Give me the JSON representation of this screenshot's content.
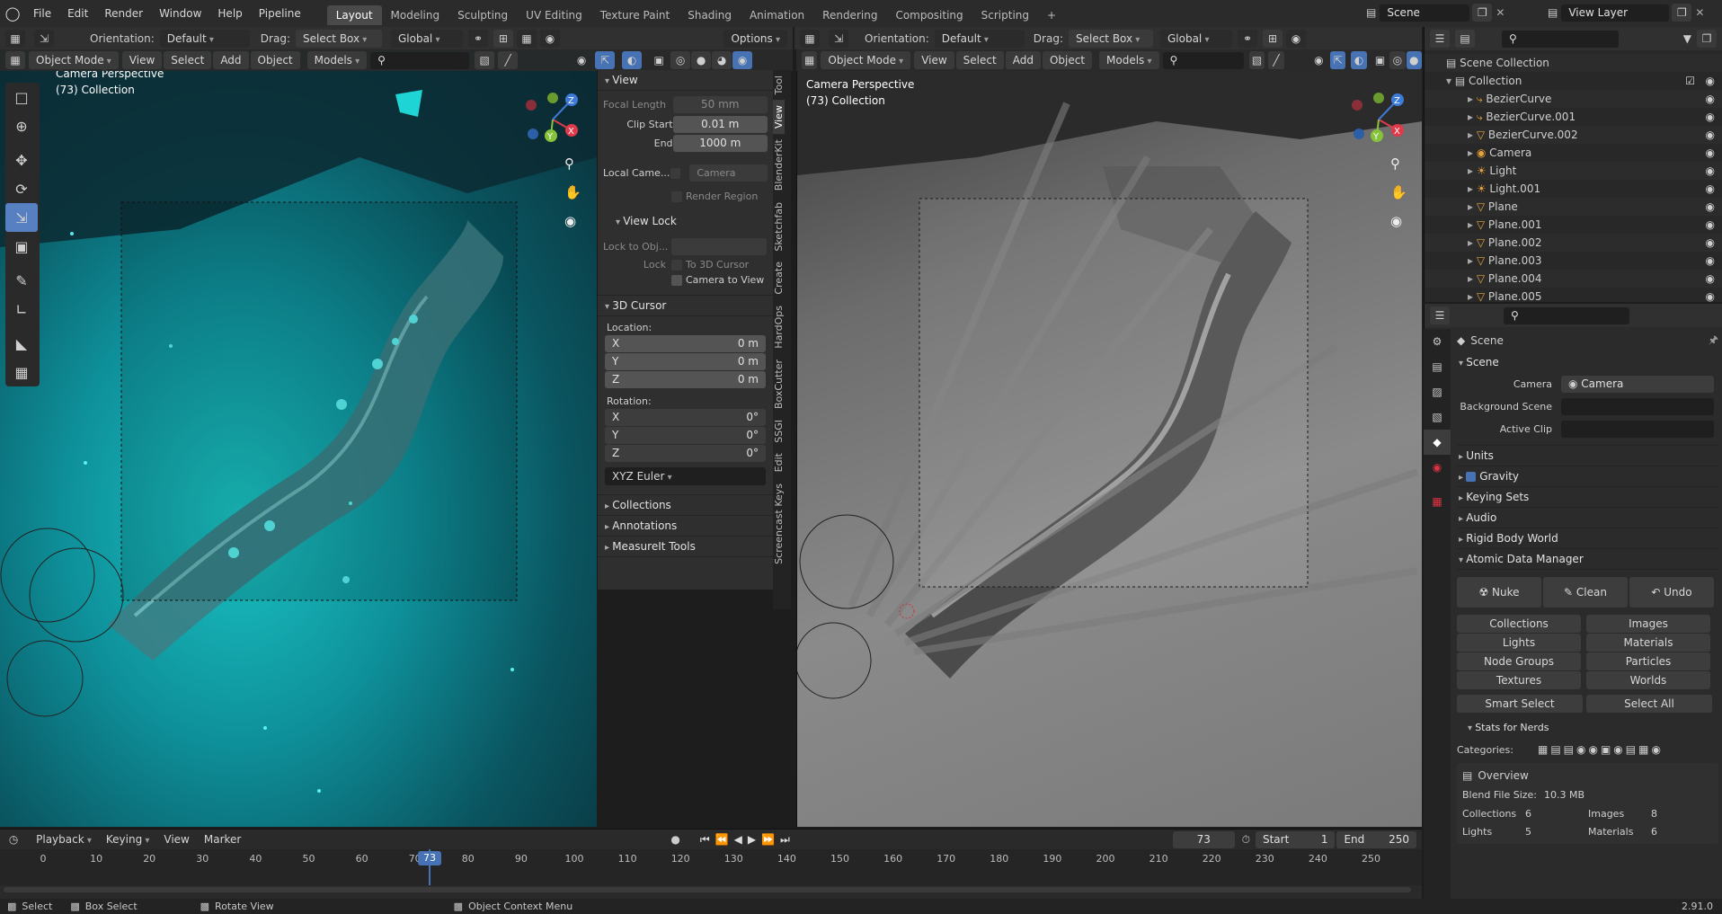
{
  "topbar": {
    "menus": [
      "File",
      "Edit",
      "Render",
      "Window",
      "Help",
      "Pipeline"
    ],
    "workspaces": [
      "Layout",
      "Modeling",
      "Sculpting",
      "UV Editing",
      "Texture Paint",
      "Shading",
      "Animation",
      "Rendering",
      "Compositing",
      "Scripting"
    ],
    "active_workspace": "Layout",
    "add_tab": "+",
    "scene": "Scene",
    "view_layer": "View Layer"
  },
  "left_viewport": {
    "orientation_label": "Orientation:",
    "orientation_value": "Default",
    "drag_label": "Drag:",
    "drag_value": "Select Box",
    "transform_value": "Global",
    "options": "Options",
    "mode": "Object Mode",
    "menu": [
      "View",
      "Select",
      "Add",
      "Object"
    ],
    "models": "Models",
    "overlay_title": "Camera Perspective",
    "overlay_sub": "(73) Collection"
  },
  "right_viewport": {
    "orientation_label": "Orientation:",
    "orientation_value": "Default",
    "drag_label": "Drag:",
    "drag_value": "Select Box",
    "transform_value": "Global",
    "mode": "Object Mode",
    "menu": [
      "View",
      "Select",
      "Add",
      "Object"
    ],
    "models": "Models",
    "overlay_title": "Camera Perspective",
    "overlay_sub": "(73) Collection"
  },
  "npanel": {
    "view_title": "View",
    "focal_length_label": "Focal Length",
    "focal_length": "50 mm",
    "clip_start_label": "Clip Start",
    "clip_start": "0.01 m",
    "clip_end_label": "End",
    "clip_end": "1000 m",
    "local_camera_label": "Local Came...",
    "local_camera_value": "Camera",
    "render_region": "Render Region",
    "view_lock_title": "View Lock",
    "lock_to_obj": "Lock to Obj...",
    "lock_label": "Lock",
    "to_3d_cursor": "To 3D Cursor",
    "camera_to_view": "Camera to View",
    "cursor_title": "3D Cursor",
    "location_label": "Location:",
    "loc": [
      {
        "axis": "X",
        "value": "0 m"
      },
      {
        "axis": "Y",
        "value": "0 m"
      },
      {
        "axis": "Z",
        "value": "0 m"
      }
    ],
    "rotation_label": "Rotation:",
    "rot": [
      {
        "axis": "X",
        "value": "0°"
      },
      {
        "axis": "Y",
        "value": "0°"
      },
      {
        "axis": "Z",
        "value": "0°"
      }
    ],
    "rotation_mode": "XYZ Euler",
    "collapsed": [
      "Collections",
      "Annotations",
      "MeasureIt Tools"
    ],
    "tabs": [
      "Tool",
      "View",
      "BlenderKit",
      "Sketchfab",
      "Create",
      "HardOps",
      "BoxCutter",
      "SSGI",
      "Edit",
      "Screencast Keys"
    ]
  },
  "outliner": {
    "root": "Scene Collection",
    "collection": "Collection",
    "items": [
      "BezierCurve",
      "BezierCurve.001",
      "BezierCurve.002",
      "Camera",
      "Light",
      "Light.001",
      "Plane",
      "Plane.001",
      "Plane.002",
      "Plane.003",
      "Plane.004",
      "Plane.005"
    ]
  },
  "properties": {
    "breadcrumb": "Scene",
    "scene_panel": "Scene",
    "camera_label": "Camera",
    "camera_value": "Camera",
    "background_scene_label": "Background Scene",
    "active_clip_label": "Active Clip",
    "units": "Units",
    "gravity": "Gravity",
    "keying_sets": "Keying Sets",
    "audio": "Audio",
    "rigid_body_world": "Rigid Body World",
    "atomic": "Atomic Data Manager",
    "nuke": "Nuke",
    "clean": "Clean",
    "undo": "Undo",
    "data_left": [
      "Collections",
      "Lights",
      "Node Groups",
      "Textures"
    ],
    "data_right": [
      "Images",
      "Materials",
      "Particles",
      "Worlds"
    ],
    "smart_select": "Smart Select",
    "select_all": "Select All",
    "stats": "Stats for Nerds",
    "categories": "Categories:",
    "overview": "Overview",
    "blend_size_label": "Blend File Size:",
    "blend_size": "10.3 MB",
    "collections_label": "Collections",
    "collections_count": "6",
    "images_label": "Images",
    "images_count": "8",
    "lights_label": "Lights",
    "lights_count": "5",
    "materials_label": "Materials",
    "materials_count": "6"
  },
  "timeline": {
    "playback": "Playback",
    "keying": "Keying",
    "view": "View",
    "marker": "Marker",
    "current_frame": "73",
    "start_label": "Start",
    "start": "1",
    "end_label": "End",
    "end": "250",
    "ticks": [
      "0",
      "10",
      "20",
      "30",
      "40",
      "50",
      "60",
      "70",
      "80",
      "90",
      "100",
      "110",
      "120",
      "130",
      "140",
      "150",
      "160",
      "170",
      "180",
      "190",
      "200",
      "210",
      "220",
      "230",
      "240",
      "250"
    ]
  },
  "statusbar": {
    "select": "Select",
    "box_select": "Box Select",
    "rotate_view": "Rotate View",
    "context_menu": "Object Context Menu",
    "version": "2.91.0"
  },
  "colors": {
    "accent": "#5680c2",
    "active_frame": "#4772b3",
    "teal": "#1ac4c4"
  }
}
